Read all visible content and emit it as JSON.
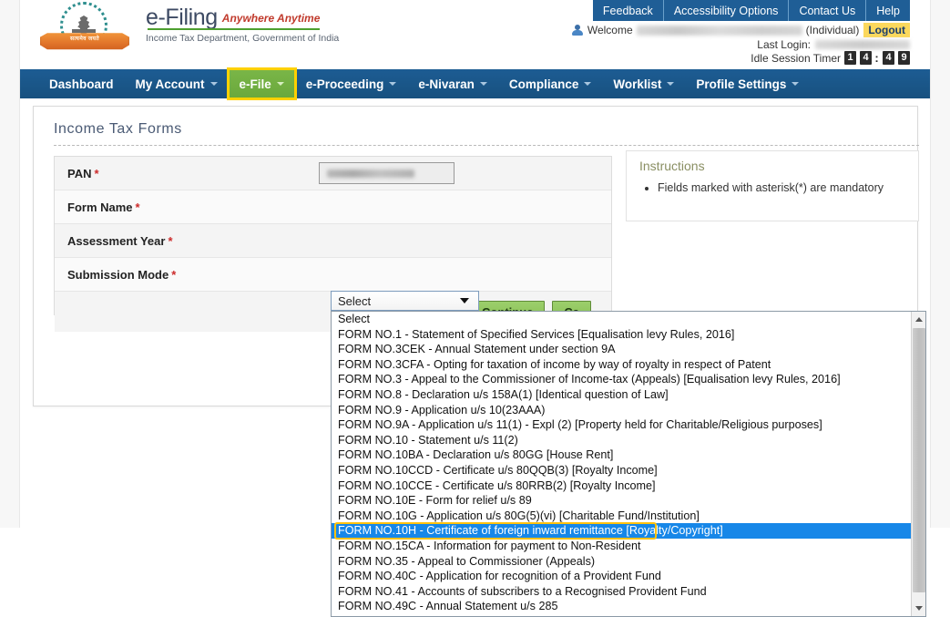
{
  "brand": {
    "title": "e-Filing",
    "tagline": "Anywhere Anytime",
    "subtitle": "Income Tax Department, Government of India",
    "emblem_text": "सत्यमेव जयते",
    "logo_icon": "india-emblem-icon"
  },
  "header": {
    "top_links": [
      "Feedback",
      "Accessibility Options",
      "Contact Us",
      "Help"
    ],
    "welcome_label": "Welcome",
    "user_name_masked": "",
    "user_type": "(Individual)",
    "logout_label": "Logout",
    "last_login_label": "Last Login:",
    "last_login_value_masked": "",
    "idle_timer_label": "Idle Session Timer",
    "idle_timer_digits": [
      "1",
      "4",
      "4",
      "9"
    ],
    "idle_timer_separator": ":"
  },
  "nav": {
    "items": [
      {
        "label": "Dashboard",
        "caret": false,
        "active": false
      },
      {
        "label": "My Account",
        "caret": true,
        "active": false
      },
      {
        "label": "e-File",
        "caret": true,
        "active": true
      },
      {
        "label": "e-Proceeding",
        "caret": true,
        "active": false
      },
      {
        "label": "e-Nivaran",
        "caret": true,
        "active": false
      },
      {
        "label": "Compliance",
        "caret": true,
        "active": false
      },
      {
        "label": "Worklist",
        "caret": true,
        "active": false
      },
      {
        "label": "Profile Settings",
        "caret": true,
        "active": false
      }
    ]
  },
  "page": {
    "title": "Income Tax Forms"
  },
  "form": {
    "rows": [
      {
        "label": "PAN",
        "required": true
      },
      {
        "label": "Form Name",
        "required": true
      },
      {
        "label": "Assessment Year",
        "required": true
      },
      {
        "label": "Submission Mode",
        "required": true
      }
    ],
    "continue_label": "Continue",
    "cancel_label": "Ca"
  },
  "instructions": {
    "title": "Instructions",
    "items": [
      "Fields marked with asterisk(*) are mandatory"
    ],
    "asterisk": "(*)"
  },
  "form_name_select": {
    "value": "Select",
    "placeholder": "Select",
    "expanded": true,
    "selected_index": 14,
    "options": [
      "Select",
      "FORM NO.1 - Statement of Specified Services [Equalisation levy Rules, 2016]",
      "FORM NO.3CEK - Annual Statement under section 9A",
      "FORM NO.3CFA - Opting for taxation of income by way of royalty in respect of Patent",
      "FORM NO.3 - Appeal to the Commissioner of Income-tax (Appeals) [Equalisation levy Rules, 2016]",
      "FORM NO.8 - Declaration u/s 158A(1) [Identical question of Law]",
      "FORM NO.9 - Application u/s 10(23AAA)",
      "FORM NO.9A - Application u/s 11(1) - Expl (2) [Property held for Charitable/Religious purposes]",
      "FORM NO.10 - Statement u/s 11(2)",
      "FORM NO.10BA - Declaration u/s 80GG [House Rent]",
      "FORM NO.10CCD - Certificate u/s 80QQB(3) [Royalty Income]",
      "FORM NO.10CCE - Certificate u/s 80RRB(2) [Royalty Income]",
      "FORM NO.10E - Form for relief u/s 89",
      "FORM NO.10G - Application u/s 80G(5)(vi) [Charitable Fund/Institution]",
      "FORM NO.10H - Certificate of foreign inward remittance [Royalty/Copyright]",
      "FORM NO.15CA - Information for payment to Non-Resident",
      "FORM NO.35 - Appeal to Commissioner (Appeals)",
      "FORM NO.40C - Application for recognition of a Provident Fund",
      "FORM NO.41 - Accounts of subscribers to a Recognised Provident Fund",
      "FORM NO.49C - Annual Statement u/s 285"
    ]
  },
  "colors": {
    "nav_blue": "#1d5c93",
    "toplink_blue": "#1f5e96",
    "active_green": "#7ab648",
    "highlight_yellow": "#ffc20e",
    "logout_yellow": "#fbd85d",
    "selected_row_blue": "#1787e8",
    "required_red": "#cc2b2b",
    "button_green": "#9ccf6c"
  }
}
